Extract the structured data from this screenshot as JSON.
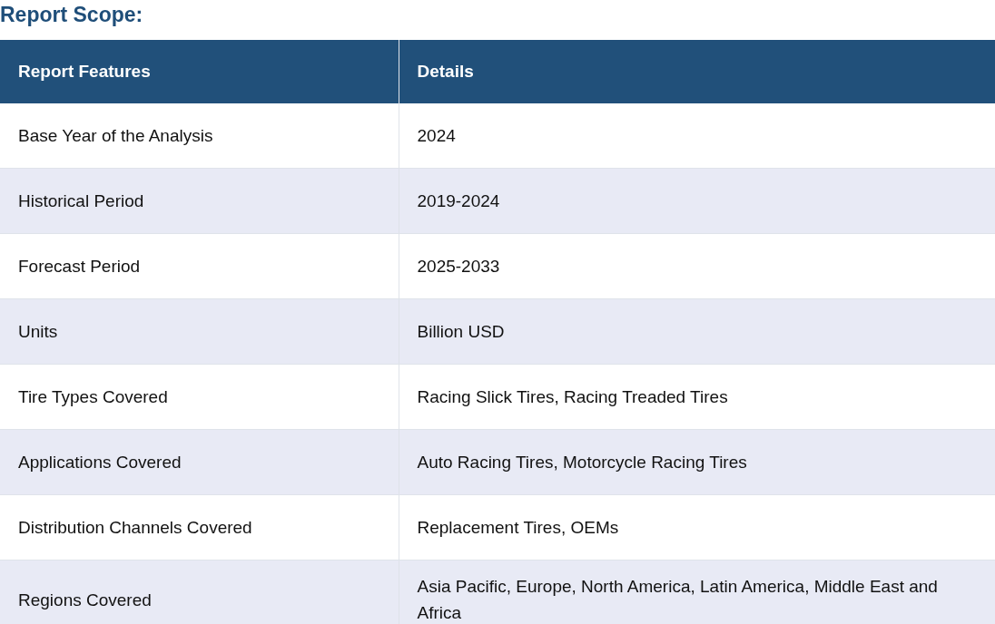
{
  "title": "Report Scope:",
  "table": {
    "columns": [
      "Report Features",
      "Details"
    ],
    "rows": [
      [
        "Base Year of the Analysis",
        "2024"
      ],
      [
        "Historical Period",
        "2019-2024"
      ],
      [
        "Forecast Period",
        "2025-2033"
      ],
      [
        "Units",
        "Billion USD"
      ],
      [
        "Tire Types Covered",
        "Racing Slick Tires, Racing Treaded Tires"
      ],
      [
        "Applications Covered",
        "Auto Racing Tires, Motorcycle Racing Tires"
      ],
      [
        "Distribution Channels Covered",
        "Replacement Tires, OEMs"
      ],
      [
        "Regions Covered",
        "Asia Pacific, Europe, North America, Latin America, Middle East and Africa"
      ]
    ]
  }
}
